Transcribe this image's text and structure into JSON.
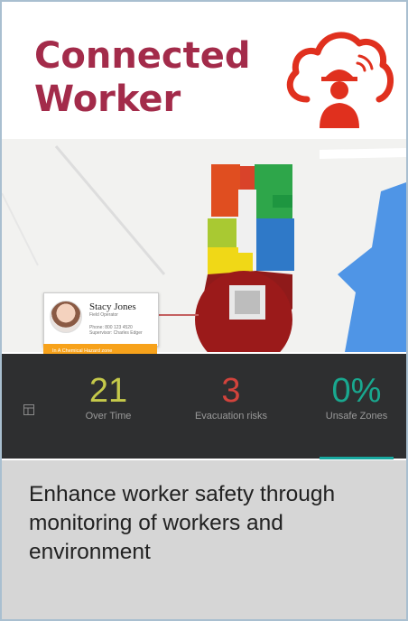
{
  "header": {
    "title_line1": "Connected",
    "title_line2": "Worker",
    "icon": "cloud-worker-signal-icon",
    "accent_color": "#a32b4a",
    "icon_color": "#e0301e"
  },
  "person_card": {
    "name": "Stacy Jones",
    "role": "Field Operator",
    "phone": "Phone: 800 123 4520",
    "supervisor": "Supervisor: Charles Edger",
    "alert": "In A Chemical Hazard zone"
  },
  "stats": [
    {
      "value": "21",
      "label": "Over Time",
      "color": "#c5c94a"
    },
    {
      "value": "3",
      "label": "Evacuation risks",
      "color": "#d2433c"
    },
    {
      "value": "0%",
      "label": "Unsafe Zones",
      "color": "#19a88f"
    }
  ],
  "description": "Enhance worker safety through monitoring of workers and environment"
}
